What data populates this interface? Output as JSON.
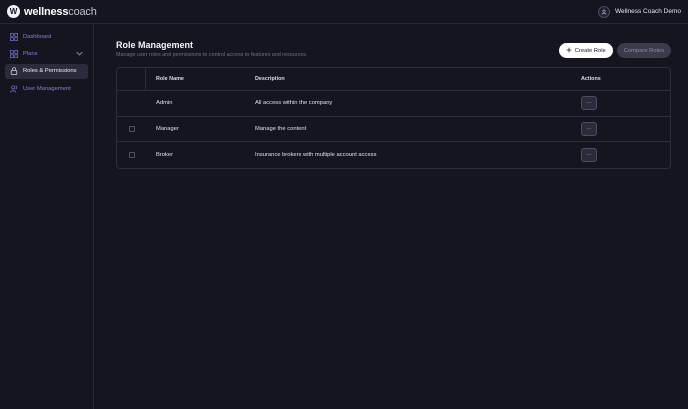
{
  "app": {
    "brand_bold": "wellness",
    "brand_light": "coach",
    "user_name": "Wellness Coach Demo"
  },
  "sidebar": {
    "items": [
      {
        "label": "Dashboard",
        "icon": "dashboard-icon",
        "active": false
      },
      {
        "label": "Plans",
        "icon": "plans-icon",
        "active": false,
        "expandable": true
      },
      {
        "label": "Roles & Permissions",
        "icon": "lock-icon",
        "active": true
      },
      {
        "label": "User Management",
        "icon": "users-icon",
        "active": false
      }
    ]
  },
  "main": {
    "title": "Role Management",
    "subtitle": "Manage user roles and permissions to control access to features and resources.",
    "create_label": "Create Role",
    "compare_label": "Compare Roles"
  },
  "table": {
    "headers": {
      "name": "Role Name",
      "description": "Description",
      "actions": "Actions"
    },
    "rows": [
      {
        "name": "Admin",
        "description": "All access within the company",
        "checkbox": false,
        "action_label": "···"
      },
      {
        "name": "Manager",
        "description": "Manage the content",
        "checkbox": true,
        "action_label": "···"
      },
      {
        "name": "Broker",
        "description": "Insurance brokers with multiple account access",
        "checkbox": true,
        "action_label": "···"
      }
    ]
  }
}
